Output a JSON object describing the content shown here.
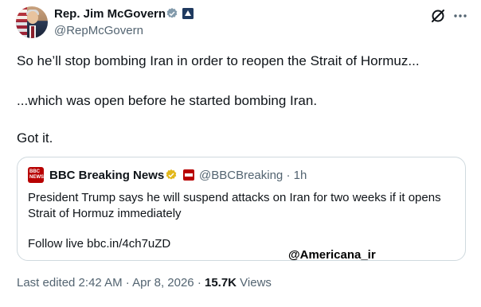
{
  "author": {
    "name": "Rep. Jim McGovern",
    "handle": "@RepMcGovern"
  },
  "tweet": {
    "line1": "So he’ll stop bombing Iran in order to reopen the Strait of Hormuz...",
    "line2": "...which was open before he started bombing Iran.",
    "line3": "Got it."
  },
  "quote": {
    "logo_text": "BBC NEWS",
    "name": "BBC Breaking News",
    "handle": "@BBCBreaking",
    "separator": "·",
    "time": "1h",
    "text": "President Trump says he will suspend attacks on Iran for two weeks if it opens Strait of Hormuz immediately",
    "link_line": "Follow live bbc.in/4ch7uZD"
  },
  "watermark": "@Americana_ir",
  "footer": {
    "edited": "Last edited 2:42 AM · Apr 8, 2026 · ",
    "views_count": "15.7K",
    "views_label": " Views"
  },
  "colors": {
    "verified_blue": "#1d9bf0",
    "gold_badge": "#e2b719",
    "bbc_red": "#b80000",
    "secondary_text": "#536471"
  },
  "icons": [
    "verified-badge-icon",
    "government-badge-icon",
    "grok-icon",
    "more-options-icon"
  ]
}
